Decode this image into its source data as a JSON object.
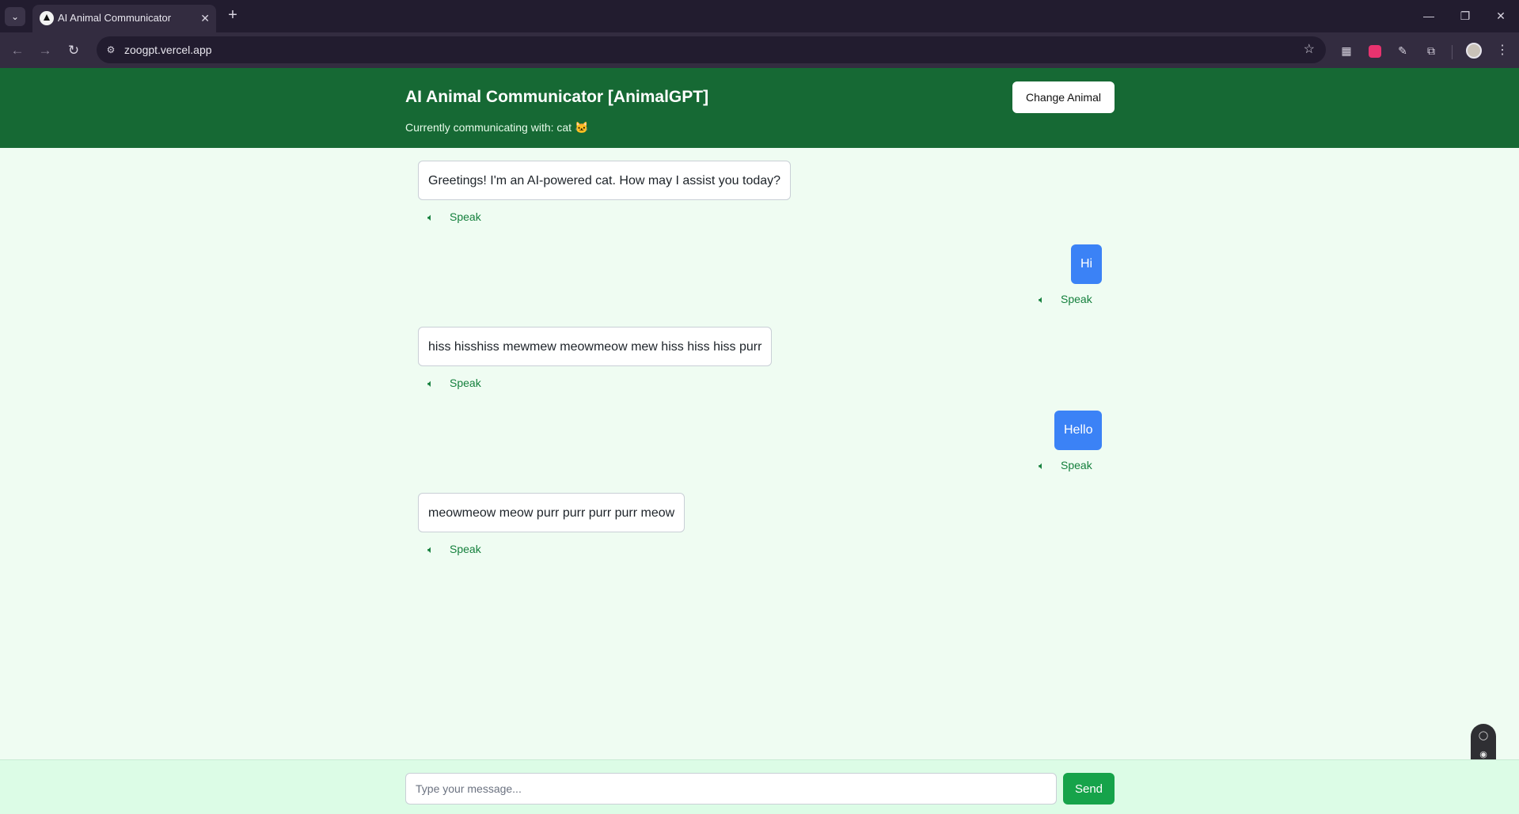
{
  "browser": {
    "tab_title": "AI Animal Communicator",
    "url": "zoogpt.vercel.app",
    "icons": {
      "tab_menu": "chevron-down-icon",
      "tab_close": "close-icon",
      "new_tab": "plus-icon",
      "back": "arrow-left-icon",
      "forward": "arrow-right-icon",
      "reload": "reload-icon",
      "site_info": "site-info-icon",
      "bookmark": "star-icon",
      "menu": "kebab-icon"
    }
  },
  "header": {
    "title": "AI Animal Communicator [AnimalGPT]",
    "subtitle": "Currently communicating with: cat 🐱",
    "change_animal_label": "Change Animal"
  },
  "messages": [
    {
      "role": "bot",
      "text": "Greetings! I'm an AI-powered cat. How may I assist you today?",
      "speak_label": "Speak"
    },
    {
      "role": "user",
      "text": "Hi",
      "speak_label": "Speak"
    },
    {
      "role": "bot",
      "text": "hiss hisshiss mewmew meowmeow mew hiss hiss hiss purr",
      "speak_label": "Speak"
    },
    {
      "role": "user",
      "text": "Hello",
      "speak_label": "Speak"
    },
    {
      "role": "bot",
      "text": "meowmeow meow purr purr purr purr meow",
      "speak_label": "Speak"
    }
  ],
  "composer": {
    "placeholder": "Type your message...",
    "value": "",
    "send_label": "Send"
  },
  "colors": {
    "header_bg": "#166934",
    "page_bg": "#effcf2",
    "user_bubble": "#3b82f6",
    "accent_green": "#15803d",
    "send_bg": "#16a34a"
  }
}
